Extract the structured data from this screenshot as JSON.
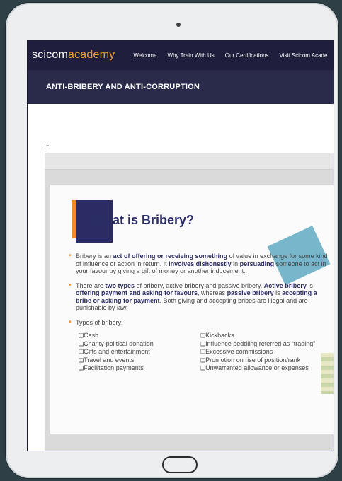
{
  "nav": {
    "logo_prefix": "scicom",
    "logo_suffix": "academy",
    "links": [
      "Welcome",
      "Why Train With Us",
      "Our Certifications",
      "Visit Scicom Acade"
    ]
  },
  "banner": {
    "title": "ANTI-BRIBERY AND ANTI-CORRUPTION"
  },
  "slide": {
    "title": "What is Bribery?",
    "bullet1": {
      "t1": "Bribery is an ",
      "b1": "act of offering or receiving something",
      "t2": " of value in exchange for some kind of influence or action in return. It ",
      "b2": "involves dishonestly",
      "t3": " in ",
      "b3": "persuading",
      "t4": " someone to act in your favour by giving a gift of money or another inducement."
    },
    "bullet2": {
      "t1": "There are ",
      "b1": "two types",
      "t2": " of bribery, active bribery and passive bribery. ",
      "b2": "Active bribery",
      "t3": " is ",
      "b3": "offering payment and asking for favours",
      "t4": ", whereas ",
      "b4": "passive bribery",
      "t5": " is ",
      "b5": "accepting a bribe or asking for payment",
      "t6": ". Both giving and accepting bribes are illegal and are punishable by law."
    },
    "bullet3": "Types of bribery:",
    "types_left": [
      "Cash",
      "Charity-political donation",
      "Gifts and entertainment",
      "Travel and events",
      "Facilitation payments"
    ],
    "types_right": [
      "Kickbacks",
      "Influence peddling referred as “trading”",
      "Excessive commissions",
      "Promotion on rise of position/rank",
      "Unwarranted allowance or expenses"
    ]
  }
}
